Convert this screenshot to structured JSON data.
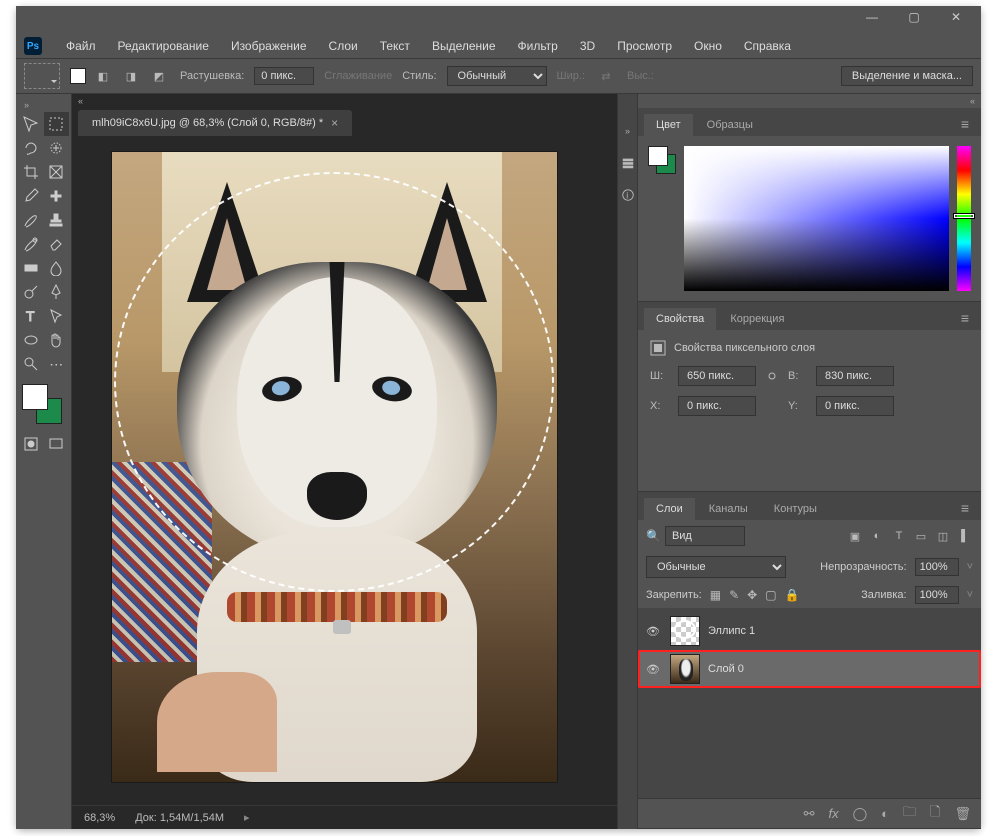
{
  "menu": {
    "file": "Файл",
    "edit": "Редактирование",
    "image": "Изображение",
    "layer": "Слои",
    "type": "Текст",
    "select": "Выделение",
    "filter": "Фильтр",
    "threeD": "3D",
    "view": "Просмотр",
    "window": "Окно",
    "help": "Справка"
  },
  "options": {
    "feather_label": "Растушевка:",
    "feather_value": "0 пикс.",
    "antialias": "Сглаживание",
    "style_label": "Стиль:",
    "style_value": "Обычный",
    "width_label": "Шир.:",
    "height_label": "Выс.:",
    "select_mask": "Выделение и маска..."
  },
  "tab": {
    "title": "mlh09iC8x6U.jpg @ 68,3% (Слой 0, RGB/8#) *"
  },
  "status": {
    "zoom": "68,3%",
    "docsize": "Док: 1,54M/1,54M"
  },
  "color_panel": {
    "tab_color": "Цвет",
    "tab_swatches": "Образцы"
  },
  "props_panel": {
    "tab_props": "Свойства",
    "tab_adjust": "Коррекция",
    "title": "Свойства пиксельного слоя",
    "w_label": "Ш:",
    "w_value": "650 пикс.",
    "h_label": "В:",
    "h_value": "830 пикс.",
    "x_label": "X:",
    "x_value": "0 пикс.",
    "y_label": "Y:",
    "y_value": "0 пикс."
  },
  "layers": {
    "tab_layers": "Слои",
    "tab_channels": "Каналы",
    "tab_paths": "Контуры",
    "search_kind": "Вид",
    "blend_mode": "Обычные",
    "opacity_label": "Непрозрачность:",
    "opacity_value": "100%",
    "lock_label": "Закрепить:",
    "fill_label": "Заливка:",
    "fill_value": "100%",
    "layer_ellipse": "Эллипс 1",
    "layer_bg": "Слой 0"
  }
}
